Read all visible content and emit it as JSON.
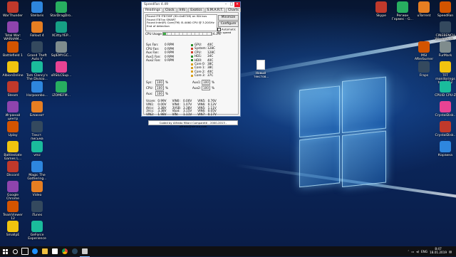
{
  "window": {
    "title": "SpeedFan 4.49",
    "tabs": [
      "Readings",
      "Clock",
      "Info",
      "Exotics",
      "S.M.A.R.T.",
      "Charts"
    ],
    "log_lines": [
      "Found ITE IT8728F (ID=0x8728) on ISA bus",
      "Found IT87xx SMART",
      "Found Intel(R) Core(TM) i5-4460 CPU @ 3.20GHz",
      "End of detection"
    ],
    "minimize_label": "Minimize",
    "configure_label": "Configure",
    "auto_fan_label": "Automatic fan speed",
    "cpu_usage_label": "CPU Usage",
    "cpu_usage_value": "6.3%",
    "fans": [
      {
        "name": "Sys Fan:",
        "value": "0 RPM"
      },
      {
        "name": "CPU Fan:",
        "value": "0 RPM"
      },
      {
        "name": "Aux Fan:",
        "value": "0 RPM"
      },
      {
        "name": "Aux1 Fan:",
        "value": "0 RPM"
      },
      {
        "name": "Aux2 Fan:",
        "value": "0 RPM"
      }
    ],
    "temps": [
      {
        "name": "GPU:",
        "value": "40C",
        "color": "#2a8c2a"
      },
      {
        "name": "System:",
        "value": "128C",
        "color": "#d23f2b"
      },
      {
        "name": "CPU:",
        "value": "128C",
        "color": "#d23f2b"
      },
      {
        "name": "HD1:",
        "value": "34C",
        "color": "#2a8c2a"
      },
      {
        "name": "HD0:",
        "value": "40C",
        "color": "#2a8c2a"
      },
      {
        "name": "Core 0:",
        "value": "38C",
        "color": "#d8a020"
      },
      {
        "name": "Core 1:",
        "value": "38C",
        "color": "#d8a020"
      },
      {
        "name": "Core 2:",
        "value": "40C",
        "color": "#d8a020"
      },
      {
        "name": "Core 3:",
        "value": "37C",
        "color": "#d8a020"
      }
    ],
    "speeds": [
      {
        "name": "Sys:",
        "value": "100",
        "unit": "%"
      },
      {
        "name": "CPU:",
        "value": "100",
        "unit": "%"
      },
      {
        "name": "Aux:",
        "value": "100",
        "unit": "%"
      },
      {
        "name": "Aux1:",
        "value": "100",
        "unit": "%"
      },
      {
        "name": "Aux2:",
        "value": "100",
        "unit": "%"
      }
    ],
    "voltages": [
      [
        "Vcore:",
        "0.99V",
        "VIN0:",
        "0.00V",
        "VIN5:",
        "0.76V"
      ],
      [
        "VIN1:",
        "0.00V",
        "VIN4:",
        "1.07V",
        "VIN6:",
        "0.12V"
      ],
      [
        "AVcc:",
        "3.38V",
        "3VSB:",
        "3.38V",
        "VIN5:",
        "1.11V"
      ],
      [
        "3Vcc:",
        "3.38V",
        "Vbat:",
        "3.15V",
        "VIN6:",
        "0.05V"
      ],
      [
        "VIN2:",
        "1.98V",
        "VIN:",
        "1.11V",
        "VIN7:",
        "0.17V"
      ]
    ],
    "coded_by": "Coded by Alfredo Milani Comparetti - 2000-2013 - alfredo@almico.com"
  },
  "desktop_icons_left": [
    [
      "WarThunder",
      "Stellaris",
      "StarDragDro..."
    ],
    [
      "Total War: WARHAM...",
      "Fallout 4",
      "XCitty.YEP..."
    ],
    [
      "Battlefield 1",
      "Grand Theft Auto V",
      "SqlEMY.GC..."
    ],
    [
      "AlbionOnline",
      "Tom Clancy's The Divisio...",
      "xRSILCSup..."
    ],
    [
      "Steam",
      "Harpoonbo...",
      "iZOMEFM..."
    ],
    [
      "Играной центр",
      "Блокнот",
      ""
    ],
    [
      "Uplay",
      "Текст. письма",
      ""
    ],
    [
      "Battlestate Games L...",
      "vmz",
      ""
    ],
    [
      "Discord",
      "Magic The Gathering...",
      ""
    ],
    [
      "Google Chrome",
      "Video",
      ""
    ],
    [
      "TeamViewer 12",
      "iTunes",
      ""
    ],
    [
      "SmallpE",
      "GeForce Experience",
      ""
    ]
  ],
  "desktop_icons_right": [
    [
      "Skype",
      "Регион Гермес - G...",
      "uTorrent",
      "SpeedFan"
    ],
    [
      "",
      "",
      "",
      "CINEBENCH Windows 6..."
    ],
    [
      "",
      "",
      "MSI Afterburner",
      "FurMark"
    ],
    [
      "",
      "",
      "Fraps",
      "TFT monitorings test 1.52"
    ],
    [
      "",
      "",
      "",
      "CPUID CPU-Z"
    ],
    [
      "",
      "",
      "",
      "CrystalDisk..."
    ],
    [
      "",
      "",
      "",
      "CrystalDisk..."
    ],
    [
      "",
      "",
      "",
      "Корзина"
    ]
  ],
  "desktop_file": "Новый текстов...",
  "taskbar": {
    "language": "ENG",
    "time": "8:47",
    "date": "18.01.2019"
  }
}
